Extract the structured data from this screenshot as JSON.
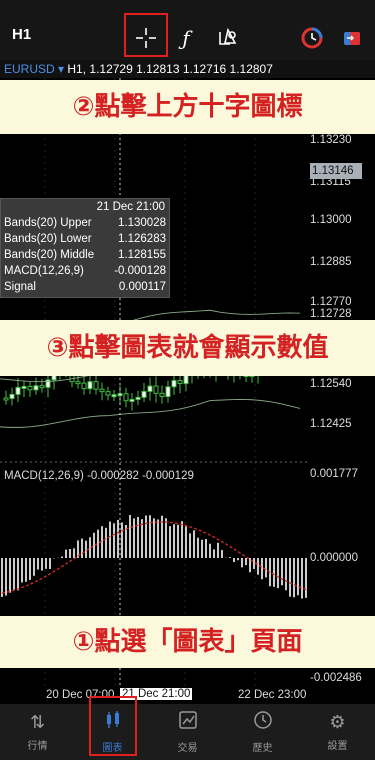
{
  "toolbar": {
    "timeframe": "H1",
    "crosshair_icon": "crosshair-icon",
    "function_icon": "function-icon",
    "objects_icon": "objects-icon",
    "indicator_icon": "indicator-icon",
    "trade_icon": "trade-icon"
  },
  "symbol_bar": {
    "symbol": "EURUSD",
    "arrow": "▾",
    "info": "H1, 1.12729 1.12813 1.12716 1.12807"
  },
  "banners": {
    "step2": "②點擊上方十字圖標",
    "step3": "③點擊圖表就會顯示數值",
    "step1": "①點選「圖表」頁面"
  },
  "price_axis": [
    "1.13230",
    "1.13115",
    "1.13000",
    "1.12885",
    "1.12770",
    "1.12728",
    "1.12540",
    "1.12425"
  ],
  "current_price": "1.13146",
  "popup": {
    "time": "21 Dec 21:00",
    "rows": [
      {
        "label": "Bands(20) Upper",
        "value": "1.130028"
      },
      {
        "label": "Bands(20) Lower",
        "value": "1.126283"
      },
      {
        "label": "Bands(20) Middle",
        "value": "1.128155"
      },
      {
        "label": "MACD(12,26,9)",
        "value": "-0.000128"
      },
      {
        "label": "Signal",
        "value": "0.000117"
      }
    ]
  },
  "macd": {
    "label": "MACD(12,26,9) -0.000282 -0.000129",
    "axis_top": "0.001777",
    "axis_mid": "0.000000",
    "axis_bottom": "-0.002486"
  },
  "time_axis": {
    "left": "20 Dec 07:00",
    "cursor": "21 Dec 21:00",
    "right": "22 Dec 23:00"
  },
  "tabs": [
    {
      "label": "行情",
      "icon": "quotes-icon"
    },
    {
      "label": "圖表",
      "icon": "chart-icon"
    },
    {
      "label": "交易",
      "icon": "trade-icon"
    },
    {
      "label": "歷史",
      "icon": "history-icon"
    },
    {
      "label": "設置",
      "icon": "settings-icon"
    }
  ],
  "colors": {
    "accent": "#3a7bd5",
    "highlight": "#e21f1f",
    "banner_bg": "#fbf8dc",
    "banner_text": "#d42222",
    "candle": "#3fbf3f",
    "signal": "#d12a2a"
  }
}
